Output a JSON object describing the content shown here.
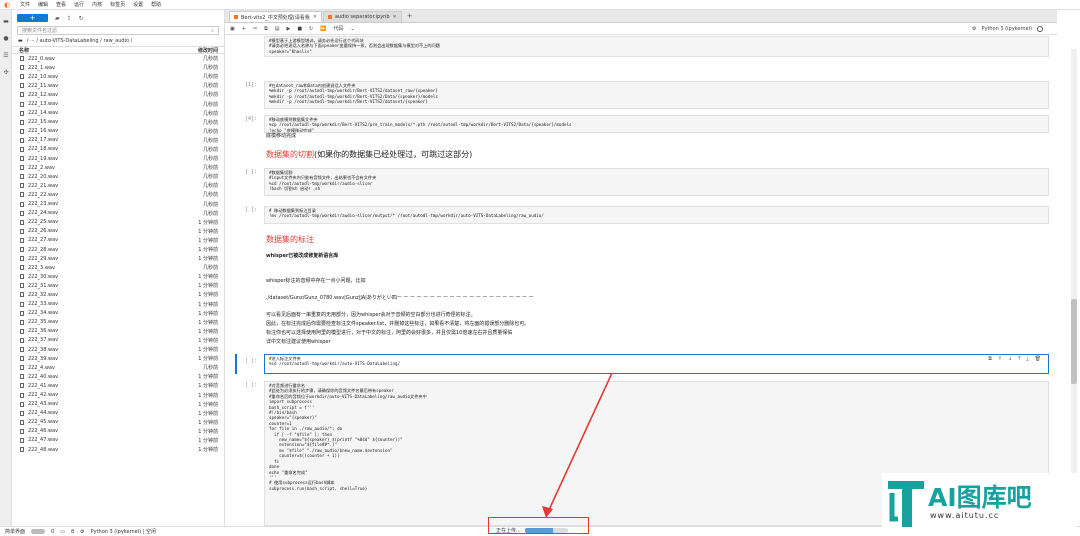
{
  "menubar": {
    "items": [
      "文件",
      "编辑",
      "查看",
      "运行",
      "内核",
      "标签页",
      "设置",
      "帮助"
    ]
  },
  "filebrowser": {
    "new_label": "+",
    "search_placeholder": "搜索文件名过滤",
    "breadcrumb": "/ ··· / auto-VITS-DataLabeling / raw_audio /",
    "col_name": "名称",
    "col_modified": "修改时间",
    "files": [
      {
        "name": "222_0.wav",
        "time": "几秒前"
      },
      {
        "name": "222_1.wav",
        "time": "几秒前"
      },
      {
        "name": "222_10.wav",
        "time": "几秒前"
      },
      {
        "name": "222_11.wav",
        "time": "几秒前"
      },
      {
        "name": "222_12.wav",
        "time": "几秒前"
      },
      {
        "name": "222_13.wav",
        "time": "几秒前"
      },
      {
        "name": "222_14.wav",
        "time": "几秒前"
      },
      {
        "name": "222_15.wav",
        "time": "几秒前"
      },
      {
        "name": "222_16.wav",
        "time": "几秒前"
      },
      {
        "name": "222_17.wav",
        "time": "几秒前"
      },
      {
        "name": "222_18.wav",
        "time": "几秒前"
      },
      {
        "name": "222_19.wav",
        "time": "几秒前"
      },
      {
        "name": "222_2.wav",
        "time": "几秒前"
      },
      {
        "name": "222_20.wav",
        "time": "几秒前"
      },
      {
        "name": "222_21.wav",
        "time": "几秒前"
      },
      {
        "name": "222_22.wav",
        "time": "几秒前"
      },
      {
        "name": "222_23.wav",
        "time": "几秒前"
      },
      {
        "name": "222_24.wav",
        "time": "几秒前"
      },
      {
        "name": "222_25.wav",
        "time": "1 分钟前"
      },
      {
        "name": "222_26.wav",
        "time": "1 分钟前"
      },
      {
        "name": "222_27.wav",
        "time": "1 分钟前"
      },
      {
        "name": "222_28.wav",
        "time": "1 分钟前"
      },
      {
        "name": "222_29.wav",
        "time": "1 分钟前"
      },
      {
        "name": "222_3.wav",
        "time": "几秒前"
      },
      {
        "name": "222_30.wav",
        "time": "1 分钟前"
      },
      {
        "name": "222_31.wav",
        "time": "1 分钟前"
      },
      {
        "name": "222_32.wav",
        "time": "1 分钟前"
      },
      {
        "name": "222_33.wav",
        "time": "1 分钟前"
      },
      {
        "name": "222_34.wav",
        "time": "1 分钟前"
      },
      {
        "name": "222_35.wav",
        "time": "1 分钟前"
      },
      {
        "name": "222_36.wav",
        "time": "1 分钟前"
      },
      {
        "name": "222_37.wav",
        "time": "1 分钟前"
      },
      {
        "name": "222_38.wav",
        "time": "1 分钟前"
      },
      {
        "name": "222_39.wav",
        "time": "1 分钟前"
      },
      {
        "name": "222_4.wav",
        "time": "几秒前"
      },
      {
        "name": "222_40.wav",
        "time": "1 分钟前"
      },
      {
        "name": "222_41.wav",
        "time": "1 分钟前"
      },
      {
        "name": "222_42.wav",
        "time": "1 分钟前"
      },
      {
        "name": "222_43.wav",
        "time": "1 分钟前"
      },
      {
        "name": "222_44.wav",
        "time": "1 分钟前"
      },
      {
        "name": "222_45.wav",
        "time": "1 分钟前"
      },
      {
        "name": "222_46.wav",
        "time": "1 分钟前"
      },
      {
        "name": "222_47.wav",
        "time": "1 分钟前"
      },
      {
        "name": "222_48.wav",
        "time": "1 分钟前"
      }
    ]
  },
  "tabs": [
    {
      "label": "Bert-vits2_中文预处理(请看我"
    },
    {
      "label": "audio separator.ipynb"
    }
  ],
  "toolbar": {
    "celltype": "代码",
    "kernel": "Python 3 (ipykernel)"
  },
  "cells": {
    "c1": "#模型基于上游模型增训，请务必先运行这个代码块\n#请务必把说话人名称与下面speaker变量保持一致，否则会出现数据集与模型对不上的问题\nspeaker=\"Khaslis\"",
    "c2_prompt": "[1]:",
    "c2": "#在dataset_raw和Data内创建说话人文件夹\n%mkdir -p /root/autodl-tmp/workdir/Bert-VITS2/dataset_raw/{speaker}\n%mkdir -p /root/autodl-tmp/workdir/Bert-VITS2/Data/{speaker}/models\n%mkdir -p /root/autodl-tmp/workdir/Bert-VITS2/dataset/{speaker}",
    "c3_prompt": "[4]:",
    "c3": "#移动底模到数据集文件夹\n%cp /root/autodl-tmp/workdir/Bert-VITS2/pre_train_models/*.pth /root/autodl-tmp/workdir/Bert-VITS2/Data/{speaker}/models\n!echo \"底模移动完成\"",
    "c3_out": "底模移动完成",
    "h1_red": "数据集的切割",
    "h1_rest": "(如果你的数据集已经处理过，可跳过这部分)",
    "c4_prompt": "[ ]:",
    "c4": "#数据集切割\n#input文件夹内只能有音频文件，出结果也不会有文件夹\n%cd /root/autodl-tmp/workdir/audio-slicer\n!bash 切割sh 启动！.sh",
    "c5_prompt": "[ ]:",
    "c5": "# 移动数据集到标注目录\n!mv /root/autodl-tmp/workdir/audio-slicer/output/* /root/autodl-tmp/workdir/auto-VITS-DataLabeling/raw_audio/",
    "h2_red": "数据集的标注",
    "md_bold": "whisper已被改成修复新语言库",
    "md1": "whisper标注的音频中存在一点小问题，比如",
    "md2": "./dataset/Gunz/Gunz_0780.wav|Gunz|JA|ありがとい四ー ー ー ー ー ー ー ー ー ー ー ー ー ー ー ー ー ー ー ー ー",
    "md3": "可以看见后面有一串重复的无用部分，因为whisper会对于音频的空白部分也进行奇怪的标注。",
    "md4": "因此，在标注完成后你需要检查标注文件speaker.list，并删掉这些标注，如果看不清楚，将左面的错误部分删除也可。",
    "md5": "标注你也可以选择使用阿里的模型进行，对于中文的标注，阿里的会好很多，并且仅需10倍速左右并且质量保佑",
    "md6": "详中文标注建议使用whisper",
    "c6_prompt": "[ ]:",
    "c6": "#进入标注文件夹\n%cd /root/autodl-tmp/workdir/auto-VITS-DataLabeling/",
    "c7_prompt": "[ ]:",
    "c7": "#对音频进行重命名\n#此处为必须执行的步骤，请确保你的音频文件名最后带有speaker\n#重命名后的音频位于workdir/auto-VITS-DataLabeling/raw_audio文件夹中\nimport subprocess\nbash_script = f'''\n#!/bin/bash\nspeaker=\"{speaker}\"\ncounter=1\nfor file in ./raw_audio/*; do\n  if [ -f \"$file\" ]; then\n    new_name=\"${speaker}_$(printf \"%04d\" ${counter})\"\n    extension=\"${file##*.}\"\n    mv \"$file\" \"./raw_audio/$new_name.$extension\"\n    counter=$((counter + 1))\n  fi\ndone\necho \"重命名完成\"\n'''\n# 使用subprocess运行bash脚本\nsubprocess.run(bash_script, shell=True)"
  },
  "status": {
    "mode_label": "简单界面",
    "count1": "0",
    "count2": "8",
    "kernel": "Python 3 (ipykernel) | 空闲",
    "upload_label": "正在上传...",
    "upload_progress": 0.65
  },
  "watermark": {
    "title": "AI图库吧",
    "url": "www.aitutu.cc"
  }
}
